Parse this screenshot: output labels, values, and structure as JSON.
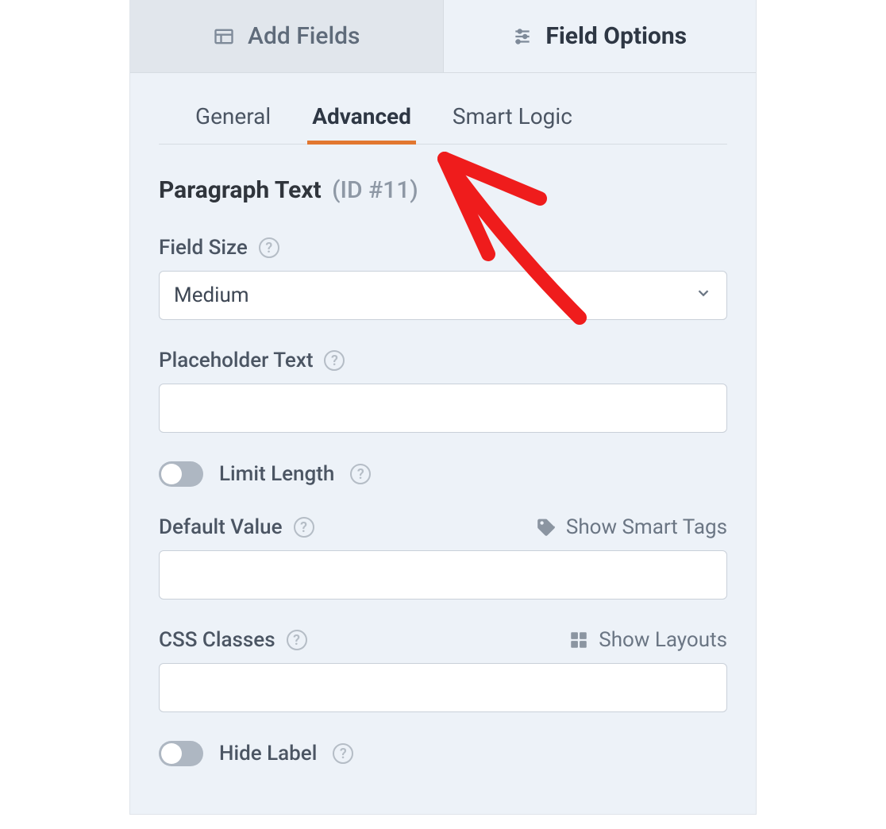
{
  "topTabs": {
    "addFields": "Add Fields",
    "fieldOptions": "Field Options"
  },
  "subTabs": {
    "general": "General",
    "advanced": "Advanced",
    "smartLogic": "Smart Logic"
  },
  "header": {
    "fieldType": "Paragraph Text",
    "idLabel": "(ID #11)"
  },
  "fields": {
    "fieldSize": {
      "label": "Field Size",
      "value": "Medium"
    },
    "placeholderText": {
      "label": "Placeholder Text",
      "value": ""
    },
    "limitLength": {
      "label": "Limit Length",
      "on": false
    },
    "defaultValue": {
      "label": "Default Value",
      "value": "",
      "smartTagsLink": "Show Smart Tags"
    },
    "cssClasses": {
      "label": "CSS Classes",
      "value": "",
      "layoutsLink": "Show Layouts"
    },
    "hideLabel": {
      "label": "Hide Label",
      "on": false
    }
  }
}
